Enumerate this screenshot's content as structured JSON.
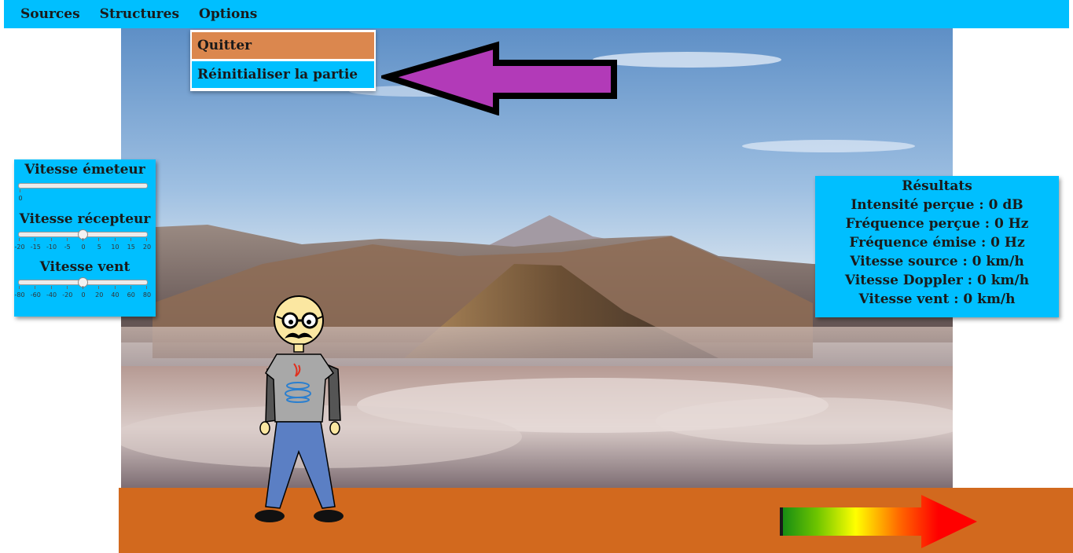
{
  "menubar": {
    "items": [
      {
        "label": "Sources"
      },
      {
        "label": "Structures"
      },
      {
        "label": "Options"
      }
    ]
  },
  "dropdown": {
    "items": [
      {
        "label": "Quitter"
      },
      {
        "label": "Réinitialiser la partie"
      }
    ]
  },
  "sliders": {
    "emitter": {
      "label": "Vitesse émeteur",
      "value": 0,
      "ticks": [
        "0"
      ]
    },
    "receiver": {
      "label": "Vitesse récepteur",
      "value": 0,
      "ticks": [
        "-20",
        "-15",
        "-10",
        "-5",
        "0",
        "5",
        "10",
        "15",
        "20"
      ]
    },
    "wind": {
      "label": "Vitesse vent",
      "value": 0,
      "ticks": [
        "-80",
        "-60",
        "-40",
        "-20",
        "0",
        "20",
        "40",
        "60",
        "80"
      ]
    }
  },
  "results": {
    "title": "Résultats",
    "lines": [
      "Intensité perçue : 0 dB",
      "Fréquence perçue : 0 Hz",
      "Fréquence émise : 0 Hz",
      "Vitesse source : 0 km/h",
      "Vitesse Doppler : 0 km/h",
      "Vitesse vent : 0 km/h"
    ]
  },
  "colors": {
    "accent": "#00bfff",
    "ground": "#d2691e",
    "quit_item": "#db874e",
    "pointer_arrow": "#b23ab8",
    "direction_arrow": "#ff0000"
  },
  "icons": {
    "character": "character-icon",
    "pointer": "purple-arrow-icon",
    "direction": "gradient-arrow-icon"
  }
}
